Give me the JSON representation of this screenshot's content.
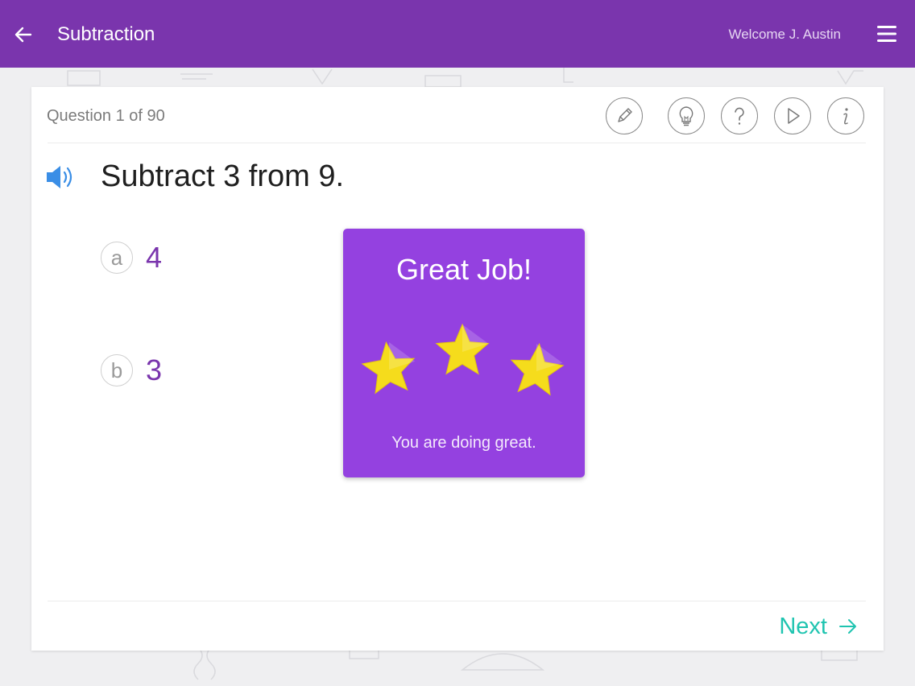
{
  "header": {
    "title": "Subtraction",
    "welcome": "Welcome J. Austin",
    "back_icon": "arrow-left-icon",
    "menu_icon": "hamburger-menu-icon",
    "color": "#7a35ad"
  },
  "question": {
    "counter": "Question 1 of 90",
    "text": "Subtract 3 from 9.",
    "audio_icon": "speaker-icon"
  },
  "tools": [
    {
      "name": "pencil-icon"
    },
    {
      "name": "lightbulb-icon"
    },
    {
      "name": "question-mark-icon"
    },
    {
      "name": "play-icon"
    },
    {
      "name": "info-icon"
    }
  ],
  "options": [
    {
      "letter": "a",
      "value": "4"
    },
    {
      "letter": "b",
      "value": "3"
    }
  ],
  "feedback": {
    "title": "Great Job!",
    "message": "You are doing great.",
    "stars_earned": 3,
    "color": "#9441e0",
    "star_color": "#f5dc1c"
  },
  "footer": {
    "next_label": "Next",
    "accent": "#1fc4b0"
  }
}
